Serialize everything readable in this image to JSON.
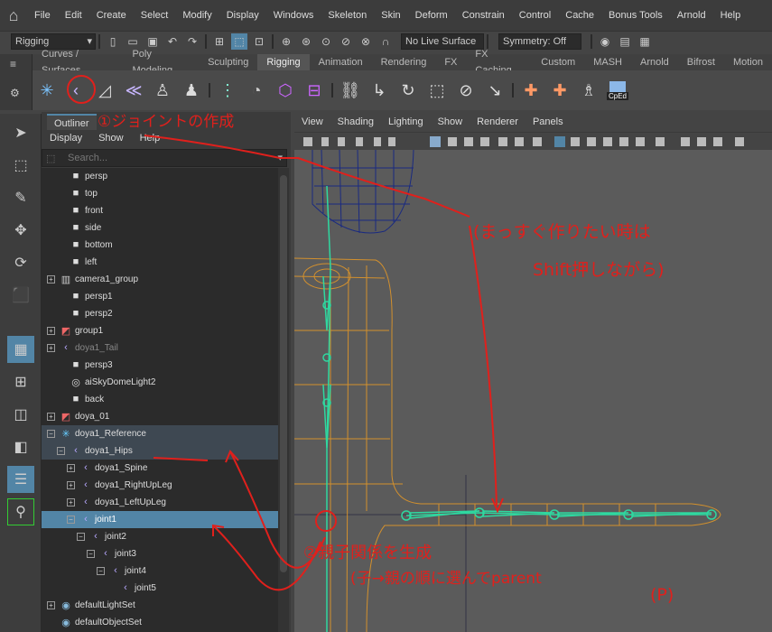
{
  "menubar": {
    "items": [
      "File",
      "Edit",
      "Create",
      "Select",
      "Modify",
      "Display",
      "Windows",
      "Skeleton",
      "Skin",
      "Deform",
      "Constrain",
      "Control",
      "Cache",
      "Bonus Tools",
      "Arnold",
      "Help"
    ]
  },
  "statusline": {
    "mode": "Rigging",
    "live_surface": "No Live Surface",
    "symmetry": "Symmetry: Off"
  },
  "shelf": {
    "tabs": [
      "Curves / Surfaces",
      "Poly Modeling",
      "Sculpting",
      "Rigging",
      "Animation",
      "Rendering",
      "FX",
      "FX Caching",
      "Custom",
      "MASH",
      "Arnold",
      "Bifrost",
      "Motion"
    ],
    "active_tab": "Rigging",
    "cped_label": "CpEd"
  },
  "outliner": {
    "tab": "Outliner",
    "menu": [
      "Display",
      "Show",
      "Help"
    ],
    "search_placeholder": "Search...",
    "rows": [
      {
        "label": "persp",
        "icon": "camera-icon",
        "expander": ""
      },
      {
        "label": "top",
        "icon": "camera-icon",
        "expander": ""
      },
      {
        "label": "front",
        "icon": "camera-icon",
        "expander": ""
      },
      {
        "label": "side",
        "icon": "camera-icon",
        "expander": ""
      },
      {
        "label": "bottom",
        "icon": "camera-icon",
        "expander": ""
      },
      {
        "label": "left",
        "icon": "camera-icon",
        "expander": ""
      },
      {
        "label": "camera1_group",
        "icon": "group-camera-icon",
        "expander": "+"
      },
      {
        "label": "persp1",
        "icon": "camera-icon",
        "expander": ""
      },
      {
        "label": "persp2",
        "icon": "camera-icon",
        "expander": ""
      },
      {
        "label": "group1",
        "icon": "group-icon",
        "expander": "+"
      },
      {
        "label": "doya1_Tail",
        "icon": "joint-icon",
        "expander": "+"
      },
      {
        "label": "persp3",
        "icon": "camera-icon",
        "expander": ""
      },
      {
        "label": "aiSkyDomeLight2",
        "icon": "light-icon",
        "expander": ""
      },
      {
        "label": "back",
        "icon": "camera-icon",
        "expander": ""
      },
      {
        "label": "doya_01",
        "icon": "group-icon",
        "expander": "+"
      },
      {
        "label": "doya1_Reference",
        "icon": "locator-icon",
        "expander": "-"
      },
      {
        "label": "doya1_Hips",
        "icon": "joint-icon",
        "expander": "-"
      },
      {
        "label": "doya1_Spine",
        "icon": "joint-icon",
        "expander": "+"
      },
      {
        "label": "doya1_RightUpLeg",
        "icon": "joint-icon",
        "expander": "+"
      },
      {
        "label": "doya1_LeftUpLeg",
        "icon": "joint-icon",
        "expander": "+"
      },
      {
        "label": "joint1",
        "icon": "joint-icon",
        "expander": "-"
      },
      {
        "label": "joint2",
        "icon": "joint-icon",
        "expander": "-"
      },
      {
        "label": "joint3",
        "icon": "joint-icon",
        "expander": "-"
      },
      {
        "label": "joint4",
        "icon": "joint-icon",
        "expander": "-"
      },
      {
        "label": "joint5",
        "icon": "joint-icon",
        "expander": ""
      },
      {
        "label": "defaultLightSet",
        "icon": "set-icon",
        "expander": "+"
      },
      {
        "label": "defaultObjectSet",
        "icon": "set-icon",
        "expander": ""
      }
    ]
  },
  "viewport": {
    "menu": [
      "View",
      "Shading",
      "Lighting",
      "Show",
      "Renderer",
      "Panels"
    ]
  },
  "annotations": {
    "note1": "①ジョイントの作成",
    "note2_line1": "(まっすぐ作りたい時は",
    "note2_line2": "Shift押しながら)",
    "note3_line1": "②親子関係を生成",
    "note3_line2": "(子→親の順に選んでparent",
    "note3_line3": "(P)"
  },
  "colors": {
    "accent": "#5285a6",
    "annotation": "#e0201c",
    "joint": "#2fd8a0",
    "wire": "#e89a26"
  }
}
